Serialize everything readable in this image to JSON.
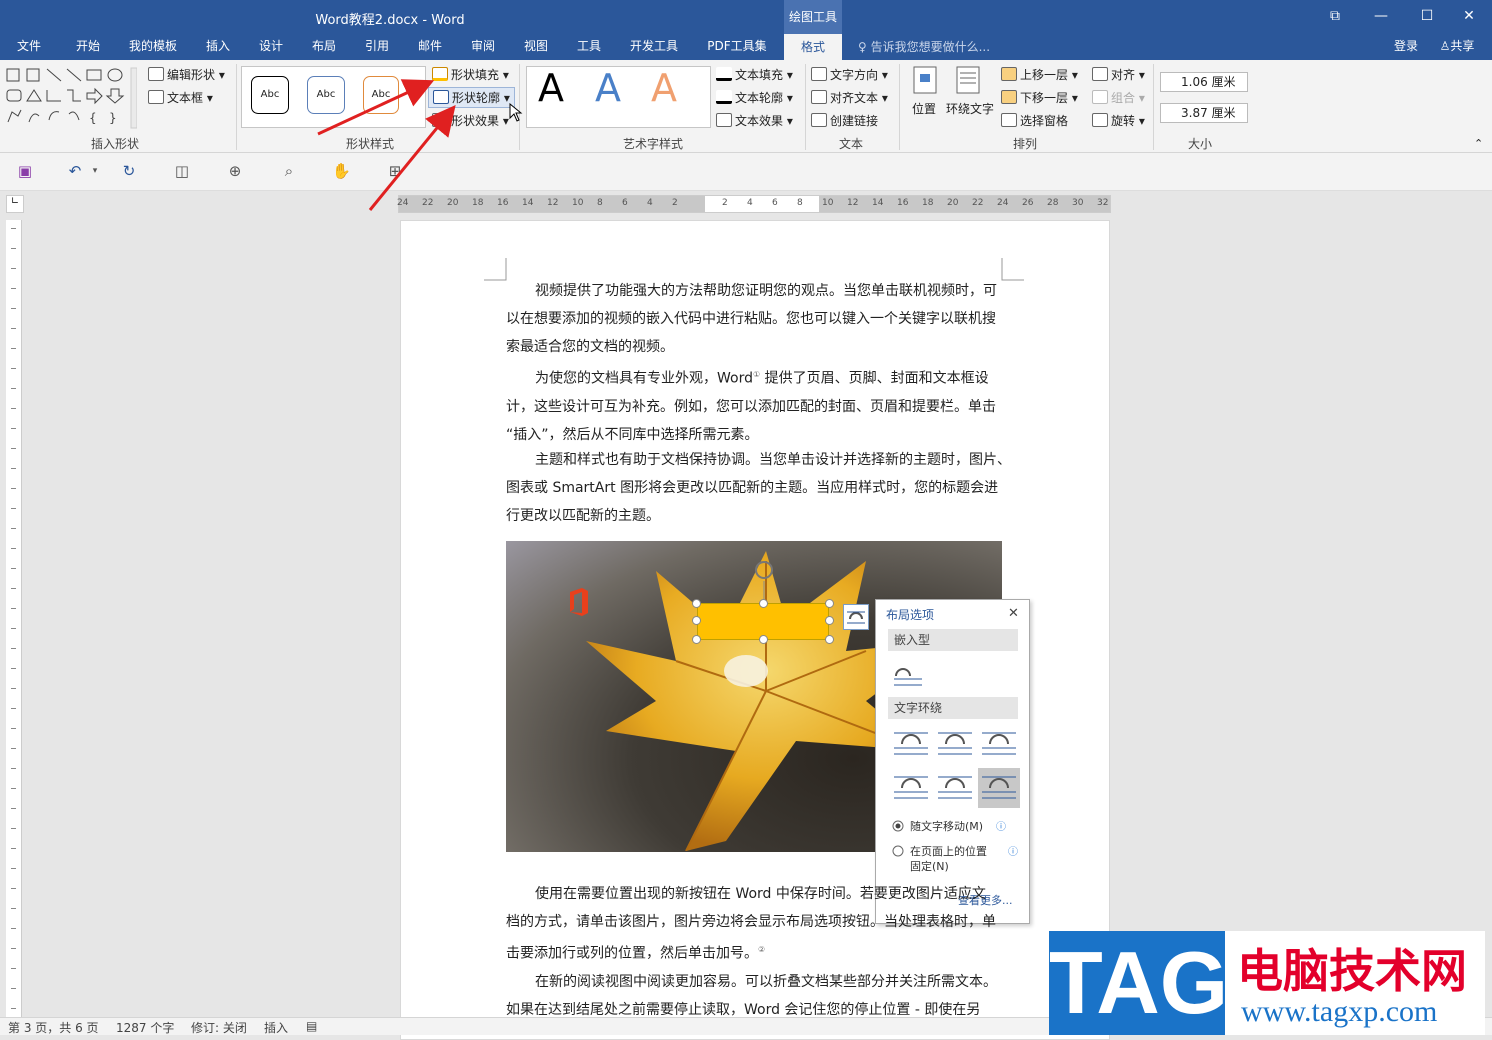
{
  "window": {
    "title": "Word教程2.docx - Word",
    "context_tab": "绘图工具",
    "restore": "⧉",
    "minimize": "—",
    "maximize": "☐",
    "close": "✕"
  },
  "tabs": [
    "文件",
    "开始",
    "我的模板",
    "插入",
    "设计",
    "布局",
    "引用",
    "邮件",
    "审阅",
    "视图",
    "工具",
    "开发工具",
    "PDF工具集",
    "格式"
  ],
  "tell_me": "告诉我您想要做什么...",
  "account": {
    "login": "登录",
    "share": "共享"
  },
  "ribbon": {
    "insert_shapes": {
      "label": "插入形状",
      "edit_shape": "编辑形状",
      "text_box": "文本框"
    },
    "shape_styles": {
      "label": "形状样式",
      "style_sample": "Abc",
      "fill": "形状填充",
      "outline": "形状轮廓",
      "effects": "形状效果"
    },
    "wordart": {
      "label": "艺术字样式",
      "sample": "A",
      "text_fill": "文本填充",
      "text_outline": "文本轮廓",
      "text_effects": "文本效果"
    },
    "text": {
      "label": "文本",
      "direction": "文字方向",
      "align": "对齐文本",
      "link": "创建链接"
    },
    "arrange": {
      "label": "排列",
      "position": "位置",
      "wrap": "环绕文字",
      "forward": "上移一层",
      "backward": "下移一层",
      "pane": "选择窗格",
      "align": "对齐",
      "group": "组合",
      "rotate": "旋转"
    },
    "size": {
      "label": "大小",
      "height": "1.06 厘米",
      "width": "3.87 厘米"
    }
  },
  "ruler_ticks": [
    "24",
    "22",
    "20",
    "18",
    "16",
    "14",
    "12",
    "10",
    "8",
    "6",
    "4",
    "2",
    "",
    "2",
    "4",
    "6",
    "8",
    "10",
    "12",
    "14",
    "16",
    "18",
    "20",
    "22",
    "24",
    "26",
    "28",
    "30",
    "32"
  ],
  "document": {
    "p1": [
      "视频提供了功能强大的方法帮助您证明您的观点。当您单击联机视频时，可",
      "以在想要添加的视频的嵌入代码中进行粘贴。您也可以键入一个关键字以联机搜",
      "索最适合您的文档的视频。"
    ],
    "p2": [
      "为使您的文档具有专业外观，Word",
      "提供了页眉、页脚、封面和文本框设",
      "计，这些设计可互为补充。例如，您可以添加匹配的封面、页眉和提要栏。单击",
      "“插入”，然后从不同库中选择所需元素。"
    ],
    "p2_footnote": "①",
    "p3": [
      "主题和样式也有助于文档保持协调。当您单击设计并选择新的主题时，图片、",
      "图表或 SmartArt 图形将会更改以匹配新的主题。当应用样式时，您的标题会进",
      "行更改以匹配新的主题。"
    ],
    "p4": [
      "使用在需要位置出现的新按钮在 Word 中保存时间。若要更改图片适应文",
      "档的方式，请单击该图片，图片旁边将会显示布局选项按钮。当处理表格时，单",
      "击要添加行或列的位置，然后单击加号。"
    ],
    "p4_footnote": "②",
    "p5": [
      "在新的阅读视图中阅读更加容易。可以折叠文档某些部分并关注所需文本。",
      "如果在达到结尾处之前需要停止读取，Word 会记住您的停止位置 - 即使在另"
    ]
  },
  "layout_panel": {
    "title": "布局选项",
    "close": "✕",
    "inline": "嵌入型",
    "wrap": "文字环绕",
    "move_with_text": "随文字移动(M)",
    "fix_position_1": "在页面上的位置",
    "fix_position_2": "固定(N)",
    "more": "查看更多..."
  },
  "status": {
    "page": "第 3 页，共 6 页",
    "words": "1287 个字",
    "track": "修订: 关闭",
    "mode": "插入"
  },
  "watermark": {
    "tag": "TAG",
    "name": "电脑技术网",
    "url": "www.tagxp.com"
  },
  "colors": {
    "accent": "#2b579a",
    "shape_fill": "#ffc000",
    "arrow": "#e02020"
  }
}
